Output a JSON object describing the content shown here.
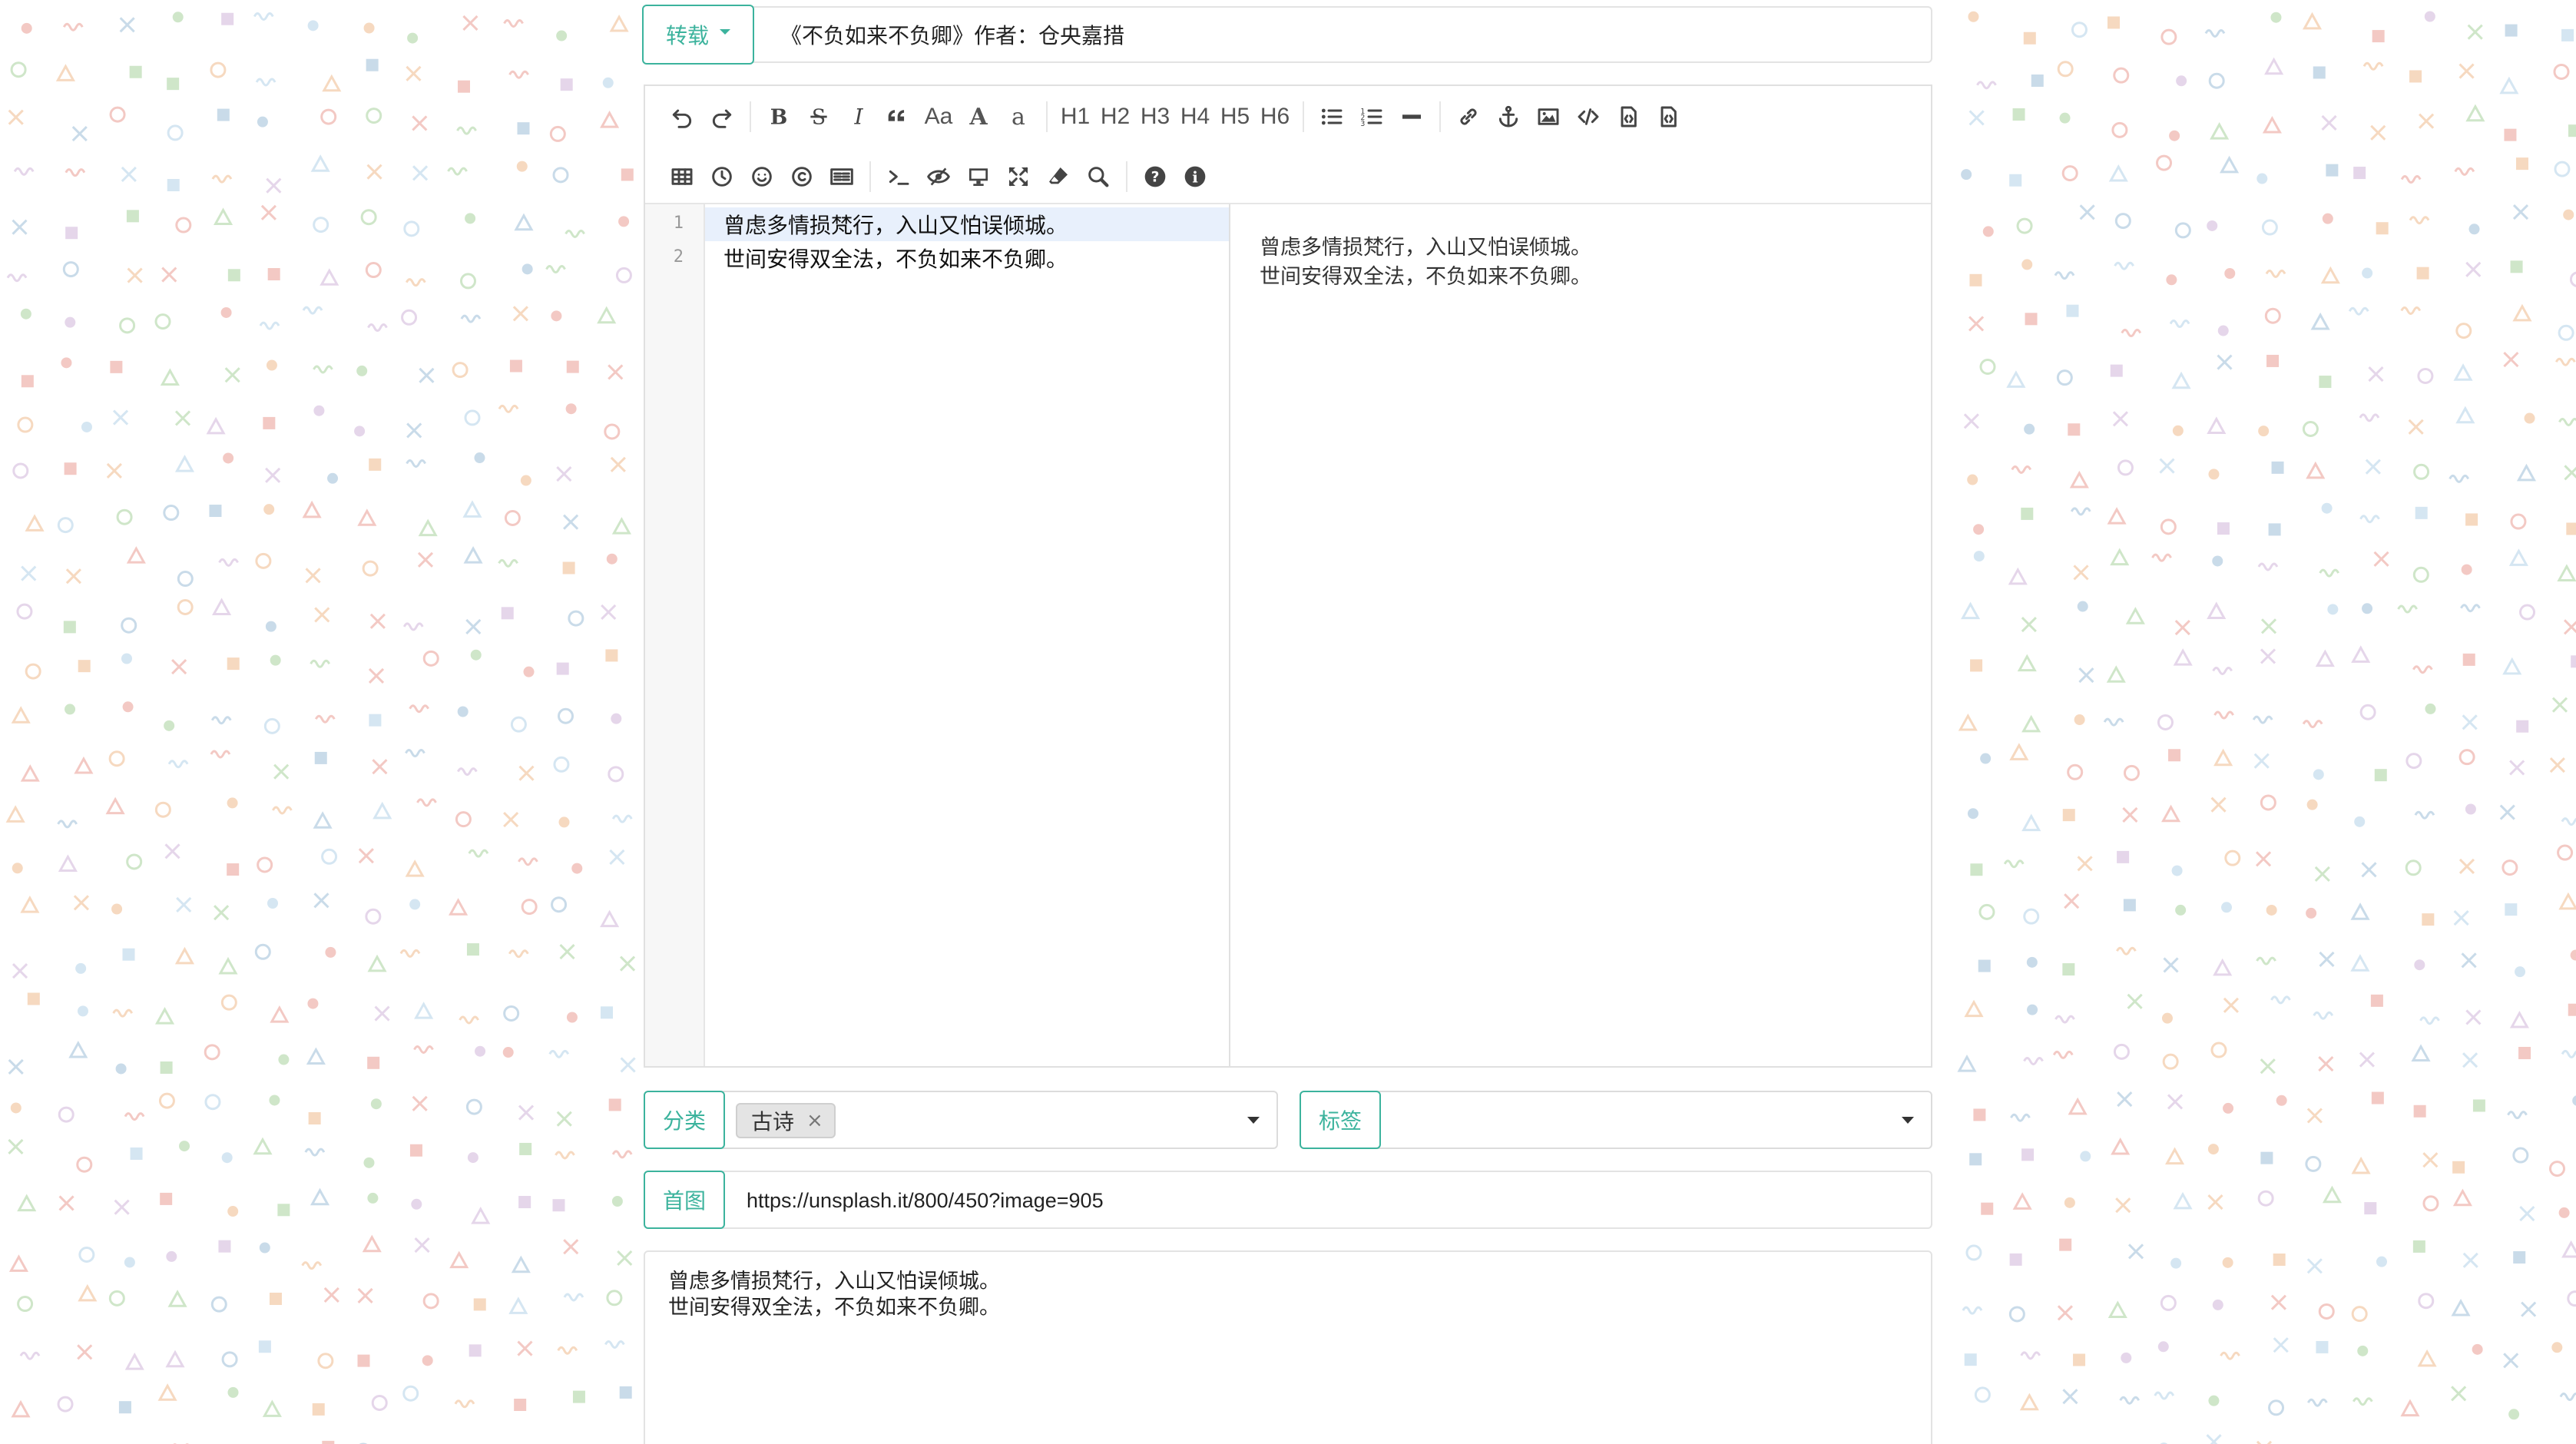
{
  "title_row": {
    "type_label": "转载",
    "title_value": "《不负如来不负卿》作者：仓央嘉措"
  },
  "toolbar": {
    "row1": [
      {
        "icon": "undo-icon"
      },
      {
        "icon": "redo-icon"
      },
      {
        "sep": true
      },
      {
        "icon": "bold-icon"
      },
      {
        "icon": "strikethrough-icon"
      },
      {
        "icon": "italic-icon"
      },
      {
        "icon": "quote-icon"
      },
      {
        "text": "Aa",
        "icon": "case-icon"
      },
      {
        "text": "A",
        "icon": "uppercase-icon"
      },
      {
        "text": "a",
        "icon": "lowercase-icon"
      },
      {
        "sep": true
      },
      {
        "text": "H1",
        "icon": "h1-icon"
      },
      {
        "text": "H2",
        "icon": "h2-icon"
      },
      {
        "text": "H3",
        "icon": "h3-icon"
      },
      {
        "text": "H4",
        "icon": "h4-icon"
      },
      {
        "text": "H5",
        "icon": "h5-icon"
      },
      {
        "text": "H6",
        "icon": "h6-icon"
      },
      {
        "sep": true
      },
      {
        "icon": "unordered-list-icon"
      },
      {
        "icon": "ordered-list-icon"
      },
      {
        "icon": "horizontal-rule-icon"
      },
      {
        "sep": true
      },
      {
        "icon": "link-icon"
      },
      {
        "icon": "anchor-icon"
      },
      {
        "icon": "image-icon"
      },
      {
        "icon": "code-icon"
      },
      {
        "icon": "preformatted-text-icon"
      },
      {
        "icon": "code-block-icon"
      }
    ],
    "row2": [
      {
        "icon": "table-icon"
      },
      {
        "icon": "datetime-icon"
      },
      {
        "icon": "emoji-icon"
      },
      {
        "icon": "html-entities-icon"
      },
      {
        "icon": "pagebreak-icon"
      },
      {
        "sep": true
      },
      {
        "icon": "terminal-icon"
      },
      {
        "icon": "watch-toggle-icon"
      },
      {
        "icon": "preview-icon"
      },
      {
        "icon": "fullscreen-icon"
      },
      {
        "icon": "clear-icon"
      },
      {
        "icon": "search-icon"
      },
      {
        "sep": true
      },
      {
        "icon": "help-icon"
      },
      {
        "icon": "info-icon"
      }
    ]
  },
  "editor": {
    "lines": [
      {
        "no": "1",
        "text": "曾虑多情损梵行，入山又怕误倾城。"
      },
      {
        "no": "2",
        "text": "世间安得双全法，不负如来不负卿。"
      }
    ],
    "preview": [
      "曾虑多情损梵行，入山又怕误倾城。",
      "世间安得双全法，不负如来不负卿。"
    ]
  },
  "category": {
    "label": "分类",
    "chip": "古诗",
    "chip_remove": "×"
  },
  "tags": {
    "label": "标签"
  },
  "cover": {
    "label": "首图",
    "url": "https://unsplash.it/800/450?image=905"
  },
  "summary": {
    "text": "曾虑多情损梵行，入山又怕误倾城。\n世间安得双全法，不负如来不负卿。"
  },
  "colors": {
    "accent": "#3cb39d",
    "border": "#e0e0e0",
    "active_line": "#e8f0fc"
  }
}
